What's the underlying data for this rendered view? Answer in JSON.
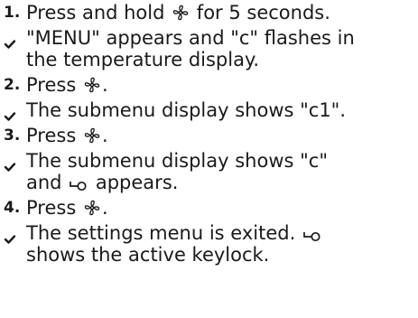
{
  "steps": [
    {
      "type": "step",
      "marker": "1.",
      "lines": [
        {
          "before": "Press and hold ",
          "icon": "fan-icon",
          "after": " for 5 seconds."
        }
      ]
    },
    {
      "type": "result",
      "lines": [
        {
          "text": "\"MENU\" appears and \"c\" flashes in"
        },
        {
          "text": "the temperature display."
        }
      ]
    },
    {
      "type": "step",
      "marker": "2.",
      "lines": [
        {
          "before": "Press ",
          "icon": "fan-icon",
          "after": "."
        }
      ]
    },
    {
      "type": "result",
      "lines": [
        {
          "text": "The submenu display shows \"c1\"."
        }
      ]
    },
    {
      "type": "step",
      "marker": "3.",
      "lines": [
        {
          "before": "Press ",
          "icon": "fan-icon",
          "after": "."
        }
      ]
    },
    {
      "type": "result",
      "lines": [
        {
          "text": "The submenu display shows \"c\""
        },
        {
          "before": "and ",
          "icon": "key-icon",
          "after": " appears."
        }
      ]
    },
    {
      "type": "step",
      "marker": "4.",
      "lines": [
        {
          "before": "Press ",
          "icon": "fan-icon",
          "after": "."
        }
      ]
    },
    {
      "type": "result",
      "lines": [
        {
          "before": "The settings menu is exited. ",
          "icon": "key-icon",
          "after": ""
        },
        {
          "text": "shows the active keylock."
        }
      ]
    }
  ]
}
